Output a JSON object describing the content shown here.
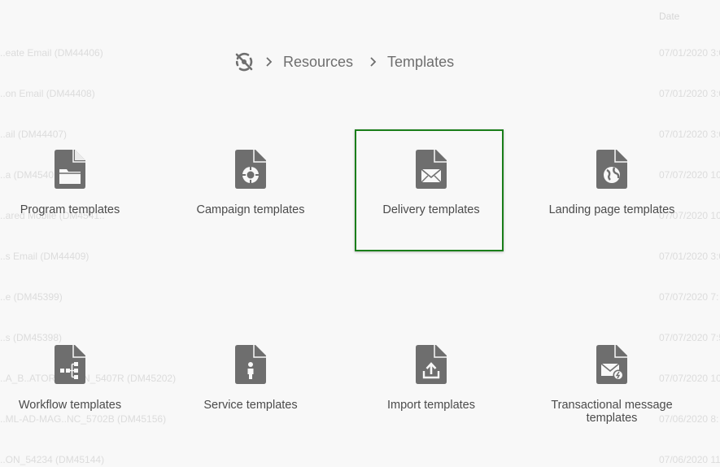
{
  "background_list": {
    "date_header": "Date",
    "rows": [
      {
        "name": "..eate Email (DM44406)",
        "date": "07/01/2020 3:0"
      },
      {
        "name": "..on Email (DM44408)",
        "date": "07/01/2020 3:0"
      },
      {
        "name": "..ail (DM44407)",
        "date": "07/01/2020 3:0"
      },
      {
        "name": "..a (DM4540..",
        "date": "07/07/2020 10"
      },
      {
        "name": "..ared Mobile (DM4541..",
        "date": "07/07/2020 10"
      },
      {
        "name": "..s Email (DM44409)",
        "date": "07/01/2020 3:0"
      },
      {
        "name": "..e (DM45399)",
        "date": "07/07/2020 7:"
      },
      {
        "name": "..s (DM45398)",
        "date": "07/07/2020 7:5"
      },
      {
        "name": "..A_B..ATOR..ATION_5407R (DM45202)",
        "date": "07/07/2020 10"
      },
      {
        "name": "..ML-AD-MAG..NC_5702B (DM45156)",
        "date": "07/06/2020 8:"
      },
      {
        "name": "..ON_54234 (DM45144)",
        "date": "07/06/2020 11"
      }
    ]
  },
  "breadcrumb": {
    "home_icon": "adobe-campaign-home-icon",
    "items": [
      "Resources",
      "Templates"
    ]
  },
  "tiles": [
    {
      "label": "Program templates",
      "icon": "folder-document-icon"
    },
    {
      "label": "Campaign templates",
      "icon": "target-document-icon"
    },
    {
      "label": "Delivery templates",
      "icon": "envelope-document-icon"
    },
    {
      "label": "Landing page templates",
      "icon": "globe-document-icon"
    },
    {
      "label": "Workflow templates",
      "icon": "workflow-document-icon"
    },
    {
      "label": "Service templates",
      "icon": "person-document-icon"
    },
    {
      "label": "Import templates",
      "icon": "upload-document-icon"
    },
    {
      "label": "Transactional message templates",
      "icon": "envelope-lightning-document-icon"
    }
  ],
  "colors": {
    "icon_gray": "#6e6e6e",
    "selection_border": "#1a7e1a",
    "text": "#4b4b4b"
  }
}
